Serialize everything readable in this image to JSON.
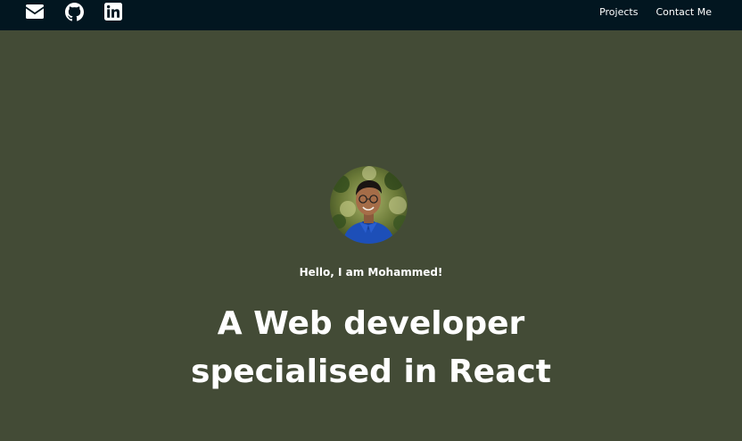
{
  "navbar": {
    "social": [
      {
        "icon": "envelope-icon",
        "label": "Email"
      },
      {
        "icon": "github-icon",
        "label": "GitHub"
      },
      {
        "icon": "linkedin-icon",
        "label": "LinkedIn"
      }
    ],
    "links": [
      {
        "label": "Projects"
      },
      {
        "label": "Contact Me"
      }
    ]
  },
  "hero": {
    "greeting": "Hello, I am Mohammed!",
    "headline_line1": "A Web developer",
    "headline_line2": "specialised in React"
  },
  "colors": {
    "navbar_bg": "#021620",
    "hero_bg": "#434b36",
    "text": "#ffffff"
  }
}
